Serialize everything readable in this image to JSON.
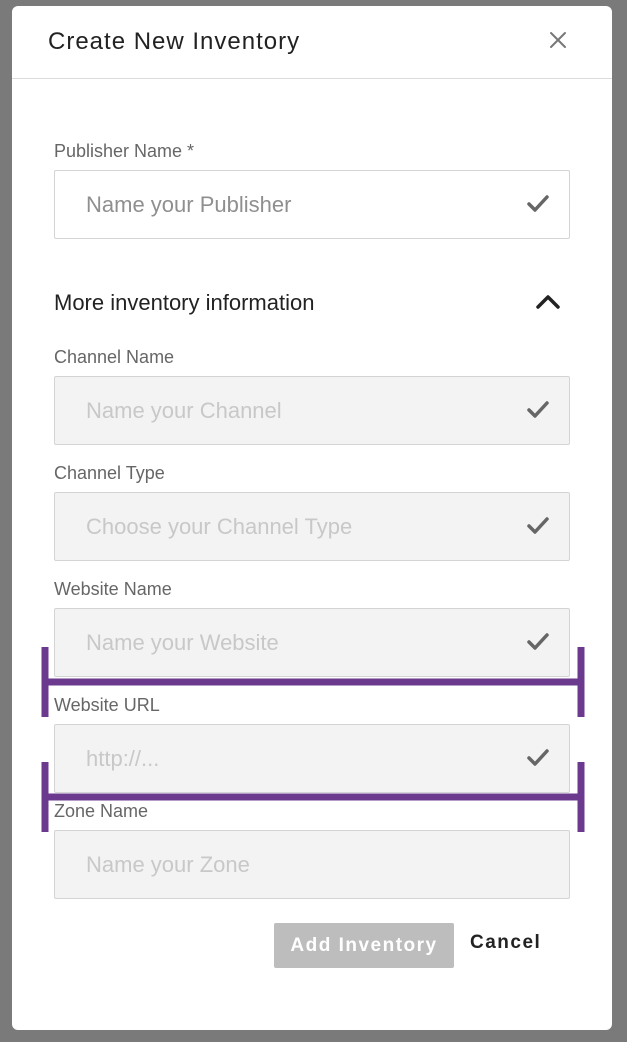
{
  "dialog": {
    "title": "Create New Inventory",
    "close_icon": "close-icon"
  },
  "fields": {
    "publisher": {
      "label": "Publisher Name *",
      "placeholder": "Name your Publisher",
      "value": ""
    },
    "channel_name": {
      "label": "Channel Name",
      "placeholder": "Name your Channel",
      "value": ""
    },
    "channel_type": {
      "label": "Channel Type",
      "placeholder": "Choose your Channel Type",
      "value": ""
    },
    "website_name": {
      "label": "Website Name",
      "placeholder": "Name your Website",
      "value": ""
    },
    "website_url": {
      "label": "Website URL",
      "placeholder": "http://...",
      "value": ""
    },
    "zone_name": {
      "label": "Zone Name",
      "placeholder": "Name your Zone",
      "value": ""
    }
  },
  "section": {
    "title": "More inventory information",
    "toggle_icon": "chevron-up-icon"
  },
  "actions": {
    "add_label": "Add Inventory",
    "cancel_label": "Cancel"
  },
  "colors": {
    "overlay": "#7a7a7a",
    "annotation_bracket": "#6b3a8f",
    "disabled_button": "#bdbdbd"
  }
}
